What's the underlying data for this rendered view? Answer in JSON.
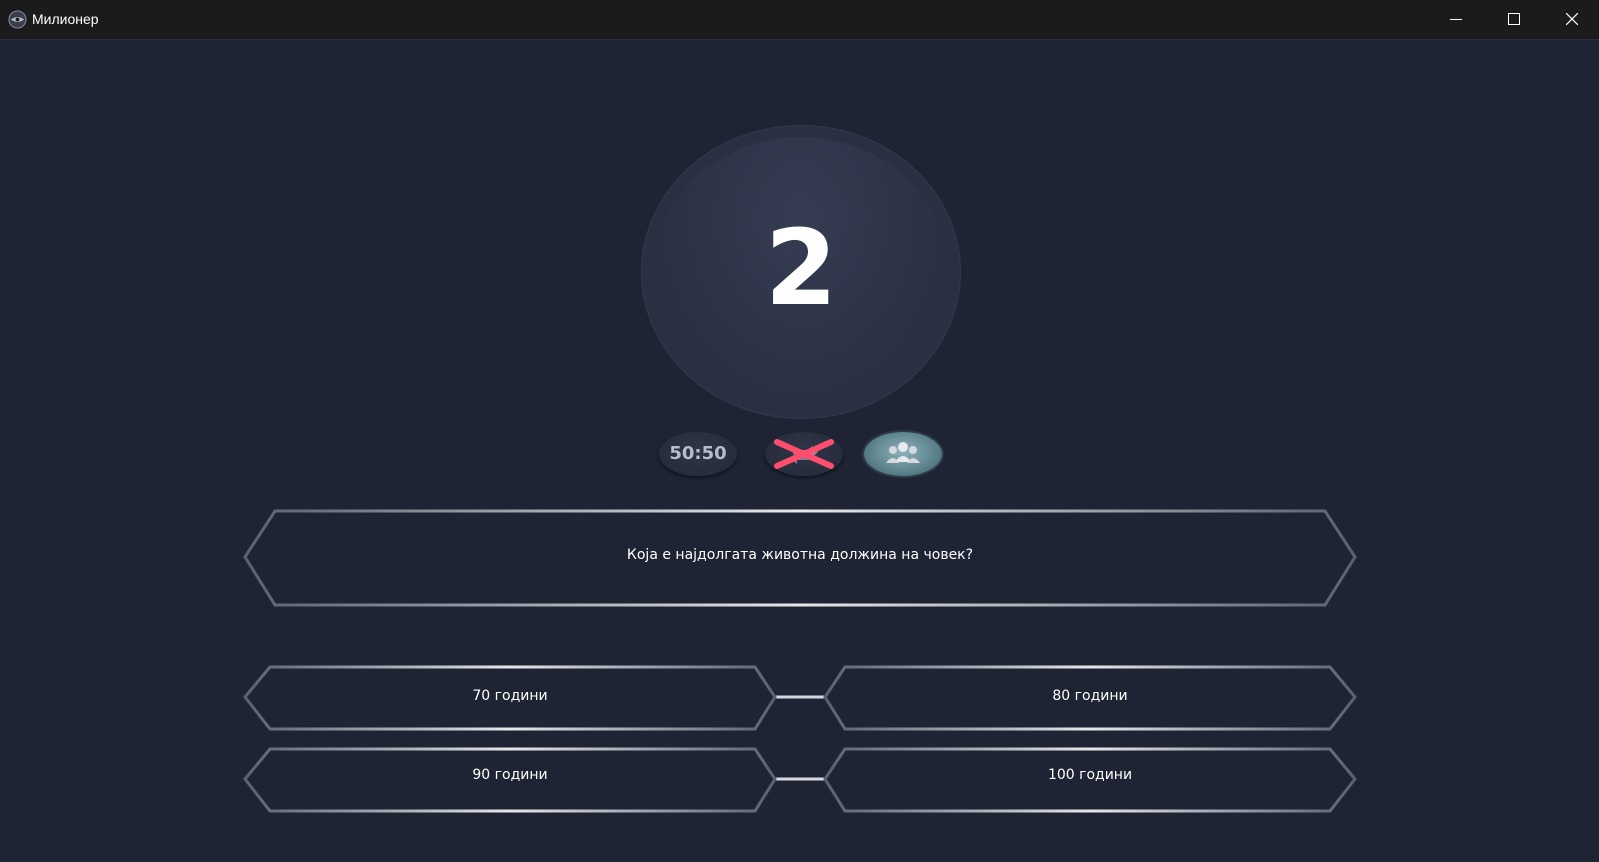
{
  "window": {
    "title": "Милионер",
    "controls": [
      "minimize-icon",
      "maximize-icon",
      "close-icon"
    ]
  },
  "timer": {
    "value": "2"
  },
  "lifelines": {
    "fifty_fifty": {
      "label": "50:50",
      "used": false
    },
    "switch_question": {
      "icon": "swap-icon",
      "used": true
    },
    "ask_audience": {
      "icon": "audience-icon",
      "used": false,
      "active": true
    }
  },
  "question": {
    "text": "Која е најдолгата животна должина на човек?"
  },
  "answers": [
    {
      "text": "70 години"
    },
    {
      "text": "80 години"
    },
    {
      "text": "90 години"
    },
    {
      "text": "100 години"
    }
  ],
  "colors": {
    "background": "#1e2433",
    "titlebar": "#1b1b1d",
    "used_cross": "#ff4d6d",
    "frame": "#c9ccd3"
  }
}
